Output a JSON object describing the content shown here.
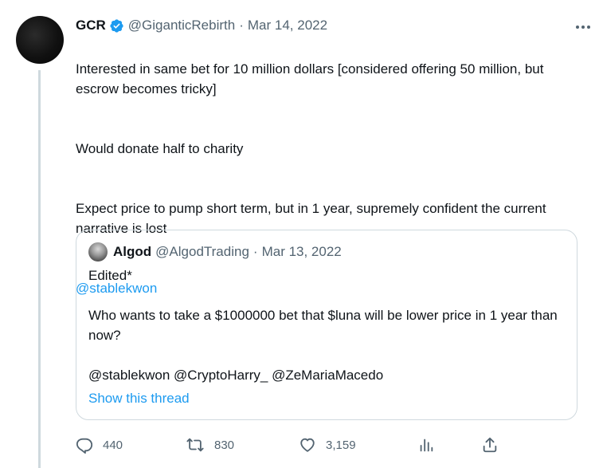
{
  "tweet": {
    "author_name": "GCR",
    "author_handle": "@GiganticRebirth",
    "separator": "·",
    "date": "Mar 14, 2022",
    "paragraphs": [
      "Interested in same bet for 10 million dollars [considered offering 50 million, but escrow becomes tricky]",
      "Would donate half to charity",
      "Expect price to pump short term, but in 1 year, supremely confident the current narrative is lost"
    ],
    "mention": "@stablekwon"
  },
  "quote": {
    "author_name": "Algod",
    "author_handle": "@AlgodTrading",
    "separator": "·",
    "date": "Mar 13, 2022",
    "paragraphs": [
      "Edited*",
      "Who wants to take a $1000000 bet that $luna will be lower price in 1 year than now?",
      "@stablekwon @CryptoHarry_ @ZeMariaMacedo"
    ],
    "show_thread_label": "Show this thread"
  },
  "actions": {
    "replies": "440",
    "retweets": "830",
    "likes": "3,159"
  },
  "colors": {
    "link": "#1d9bf0",
    "secondary_text": "#536471",
    "verified_badge": "#1d9bf0",
    "border": "#cfd9de"
  },
  "icons": {
    "verified": "verified-badge-icon",
    "more": "more-dots-icon",
    "reply": "reply-icon",
    "retweet": "retweet-icon",
    "like": "heart-icon",
    "analytics": "analytics-icon",
    "share": "share-icon"
  }
}
